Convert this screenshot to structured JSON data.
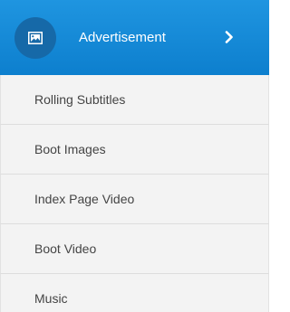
{
  "header": {
    "label": "Advertisement",
    "icon": "image-icon",
    "chevron_icon": "chevron-right-icon",
    "background_color": "#1283d4",
    "icon_circle_color": "#1669a8"
  },
  "items": [
    {
      "label": "Rolling Subtitles"
    },
    {
      "label": "Boot Images"
    },
    {
      "label": "Index Page Video"
    },
    {
      "label": "Boot Video"
    },
    {
      "label": "Music"
    }
  ]
}
